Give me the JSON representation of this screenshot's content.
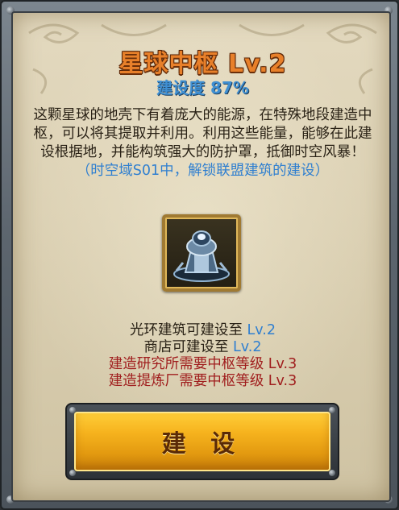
{
  "dialog": {
    "title": "星球中枢 Lv.2",
    "progress": "建设度 87%",
    "description": "这颗星球的地壳下有着庞大的能源，在特殊地段建造中枢，可以将其提取并利用。利用这些能量，能够在此建设根据地，并能构筑强大的防护罩，抵御时空风暴！",
    "note": "（时空域S01中，解锁联盟建筑的建设）",
    "icon": "planet-core-tower-icon",
    "requirements": [
      {
        "text": "光环建筑可建设至 ",
        "value": "Lv.2"
      },
      {
        "text": "商店可建设至 ",
        "value": "Lv.2"
      },
      {
        "text": "建造研究所需要中枢等级 Lv.3"
      },
      {
        "text": "建造提炼厂需要中枢等级 Lv.3"
      }
    ],
    "build_button": "建 设"
  },
  "colors": {
    "title": "#e8802a",
    "progress": "#3f8fd2",
    "link_blue": "#2f7fd0",
    "warning_red": "#a01e1e",
    "button_gold": "#f6b31e"
  }
}
